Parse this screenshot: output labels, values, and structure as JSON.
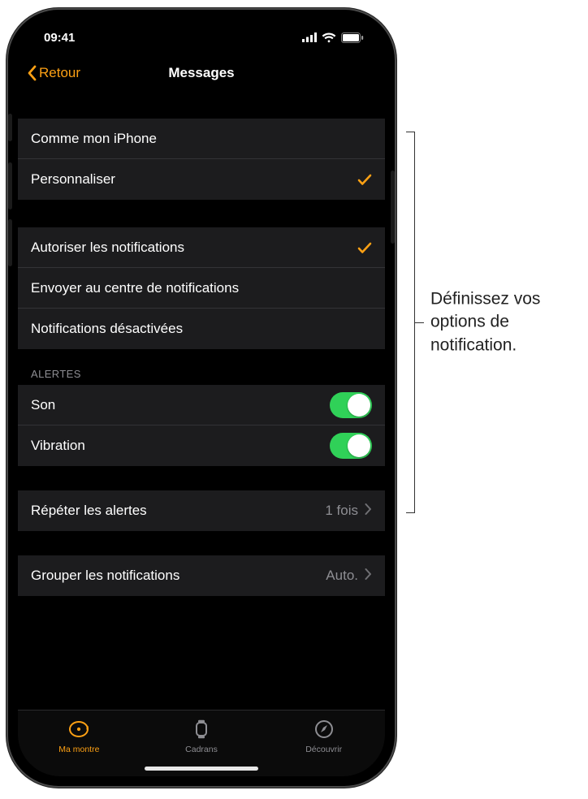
{
  "status": {
    "time": "09:41"
  },
  "nav": {
    "back": "Retour",
    "title": "Messages"
  },
  "mirror_group": {
    "mirror": "Comme mon iPhone",
    "custom": "Personnaliser"
  },
  "notif_group": {
    "allow": "Autoriser les notifications",
    "send_nc": "Envoyer au centre de notifications",
    "off": "Notifications désactivées"
  },
  "alerts": {
    "header": "ALERTES",
    "sound": "Son",
    "haptic": "Vibration"
  },
  "repeat": {
    "label": "Répéter les alertes",
    "value": "1 fois"
  },
  "grouping": {
    "label": "Grouper les notifications",
    "value": "Auto."
  },
  "tabs": {
    "my_watch": "Ma montre",
    "faces": "Cadrans",
    "discover": "Découvrir"
  },
  "callout": "Définissez vos options de notification."
}
